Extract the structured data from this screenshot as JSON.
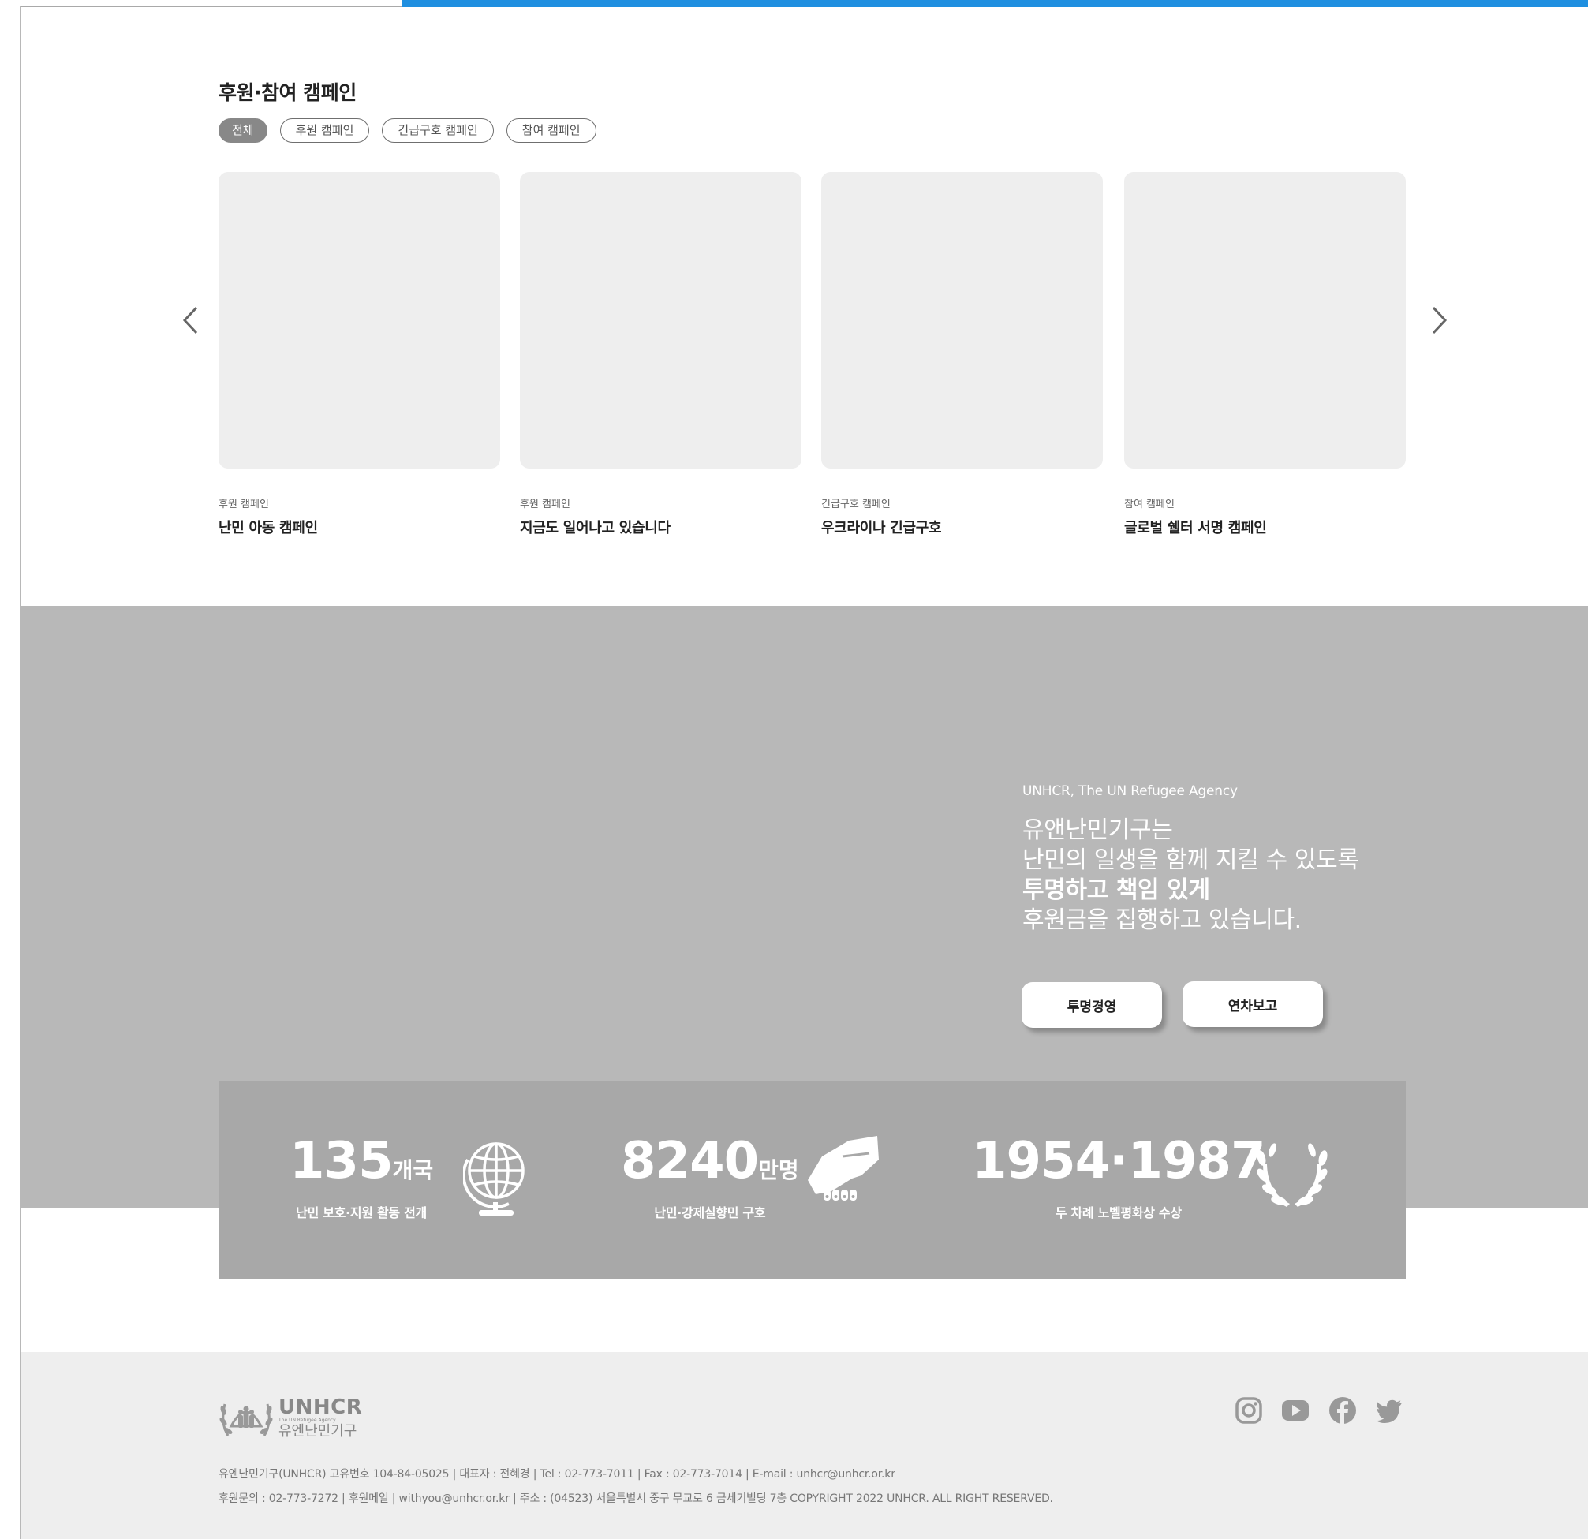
{
  "campaign": {
    "title": "후원·참여 캠페인",
    "filters": [
      "전체",
      "후원 캠페인",
      "긴급구호 캠페인",
      "참여 캠페인"
    ],
    "cards": [
      {
        "category": "후원 캠페인",
        "title": "난민 아동 캠페인"
      },
      {
        "category": "후원 캠페인",
        "title": "지금도 일어나고 있습니다"
      },
      {
        "category": "긴급구호 캠페인",
        "title": "우크라이나 긴급구호"
      },
      {
        "category": "참여 캠페인",
        "title": "글로벌 쉘터 서명 캠페인"
      }
    ]
  },
  "promo": {
    "eyebrow": "UNHCR, The UN Refugee Agency",
    "line1": "유앤난민기구는",
    "line2": "난민의 일생을 함께 지킬 수 있도록",
    "line3": "투명하고 책임 있게",
    "line4": "후원금을 집행하고 있습니다.",
    "button_transparency": "투명경영",
    "button_annual": "연차보고"
  },
  "stats": [
    {
      "value": "135",
      "unit": "개국",
      "label": "난민 보호·지원 활동 전개",
      "icon": "globe-icon"
    },
    {
      "value": "8240",
      "unit": "만명",
      "label": "난민·강제실향민 구호",
      "icon": "handshake-icon"
    },
    {
      "value": "1954·1987",
      "unit": "",
      "label": "두 차례 노벨평화상 수상",
      "icon": "laurel-icon"
    }
  ],
  "footer": {
    "logo_main": "UNHCR",
    "logo_sub": "The UN Refugee Agency",
    "logo_kr": "유엔난민기구",
    "info_line1": "유엔난민기구(UNHCR) 고유번호 104-84-05025 | 대표자 : 전혜경 | Tel : 02-773-7011 | Fax : 02-773-7014 | E-mail : unhcr@unhcr.or.kr",
    "info_line2": "후원문의 : 02-773-7272 | 후원메일 | withyou@unhcr.or.kr | 주소 : (04523) 서울특별시 중구 무교로 6 금세기빌딩 7층 COPYRIGHT 2022 UNHCR. ALL RIGHT RESERVED.",
    "social": [
      "instagram-icon",
      "youtube-icon",
      "facebook-icon",
      "twitter-icon"
    ]
  },
  "colors": {
    "accent": "#1f8fe0",
    "promo_bg": "#b8b8b8",
    "stats_bg": "#a8a8a8",
    "footer_bg": "#eeeeee",
    "card_bg": "#eeeeee"
  }
}
